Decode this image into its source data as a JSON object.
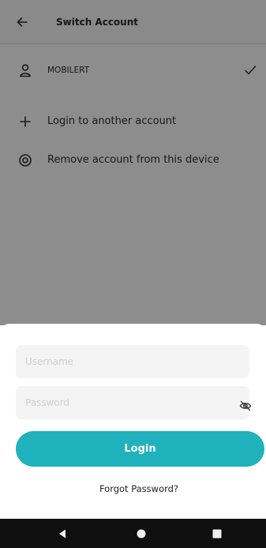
{
  "appbar": {
    "title": "Switch Account",
    "back_icon": "arrow-left-icon"
  },
  "accounts": [
    {
      "name": "MOBILERT",
      "icon": "user-icon",
      "selected": true,
      "check_icon": "checkmark-icon"
    }
  ],
  "actions": [
    {
      "label": "Login to another account",
      "icon": "plus-icon"
    },
    {
      "label": "Remove account from this device",
      "icon": "remove-target-icon"
    }
  ],
  "login_sheet": {
    "username_placeholder": "Username",
    "password_placeholder": "Password",
    "password_toggle_icon": "eye-off-icon",
    "login_label": "Login",
    "forgot_label": "Forgot Password?"
  },
  "nav": {
    "buttons": [
      "back-triangle-icon",
      "home-circle-icon",
      "recents-square-icon"
    ]
  },
  "colors": {
    "accent": "#1fb2bd",
    "scrim": "#8d8d8d",
    "navbar": "#0f0f0f"
  }
}
